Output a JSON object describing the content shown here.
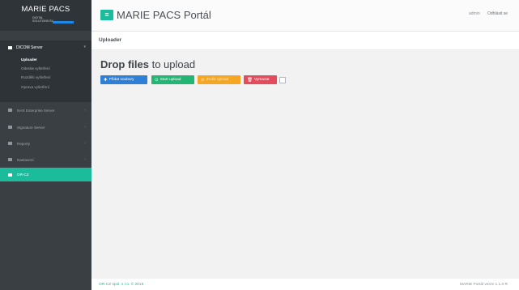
{
  "brand": {
    "title": "MARIE PACS",
    "sub_line1": "DIGITAL",
    "sub_line2": "SOLUTIONS BY"
  },
  "header": {
    "title": "MARIE PACS Portál",
    "user": "admin",
    "logout": "Odhlásit se"
  },
  "sidebar": {
    "dicom": {
      "label": "DICOM Server",
      "items": [
        "Uploader",
        "Odeslat vyšetření",
        "Rozdělit vyšetření",
        "Oprava vyšetření"
      ]
    },
    "items": [
      {
        "label": "NAS Enterprise Server"
      },
      {
        "label": "Signature Server"
      },
      {
        "label": "Reporty"
      },
      {
        "label": "Nastavení"
      },
      {
        "label": "OR-CZ"
      }
    ]
  },
  "page": {
    "heading": "Uploader"
  },
  "uploader": {
    "title_bold": "Drop files",
    "title_rest": " to upload",
    "add_files": "Přidat soubory",
    "start_upload": "Start upload",
    "cancel_upload": "Zrušit upload",
    "delete": "Vymazat"
  },
  "footer": {
    "left": "OR-CZ spol. s r.o. © 2015",
    "right": "MARIE Portál verze 1.1.0 R"
  },
  "colors": {
    "sidebar": "#3a3f44",
    "accent": "#1abc9c",
    "blue": "#2e7fd6",
    "green": "#22b573",
    "orange": "#f5a623",
    "red": "#e44b5c"
  }
}
